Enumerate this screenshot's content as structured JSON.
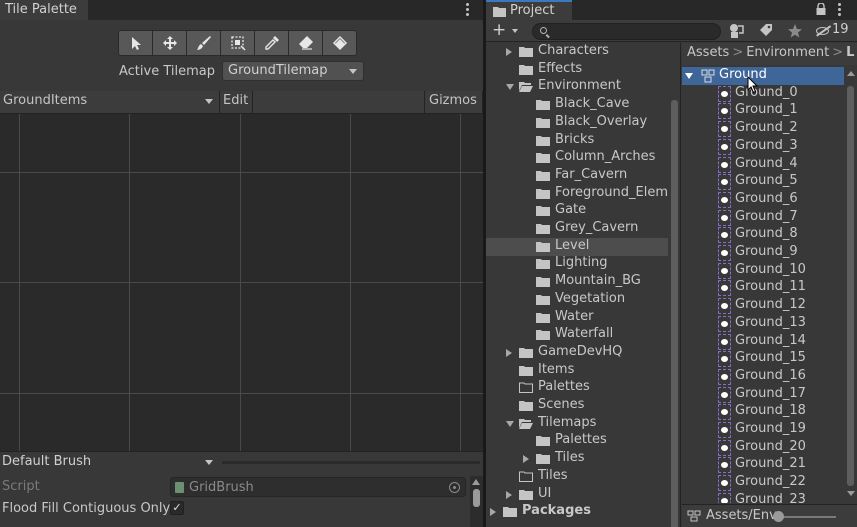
{
  "tile_palette": {
    "tab_title": "Tile Palette",
    "tools": [
      {
        "name": "select-tool-icon"
      },
      {
        "name": "move-tool-icon"
      },
      {
        "name": "paintbrush-tool-icon"
      },
      {
        "name": "box-fill-tool-icon"
      },
      {
        "name": "picker-tool-icon"
      },
      {
        "name": "eraser-tool-icon"
      },
      {
        "name": "fill-bucket-tool-icon"
      }
    ],
    "active_tilemap_label": "Active Tilemap",
    "active_tilemap_value": "GroundTilemap",
    "palette_dropdown": "GroundItems",
    "edit_label": "Edit",
    "gizmos_label": "Gizmos",
    "brush_dropdown": "Default Brush",
    "script_label": "Script",
    "script_value": "GridBrush",
    "flood_fill_label": "Flood Fill Contiguous Only",
    "flood_fill_checked": "✓"
  },
  "project": {
    "tab_title": "Project",
    "hidden_count": "19",
    "folders": [
      {
        "label": "Characters",
        "arrow": "right"
      },
      {
        "label": "Effects",
        "arrow": ""
      },
      {
        "label": "Environment",
        "arrow": "down"
      },
      {
        "label": "Black_Cave",
        "arrow": ""
      },
      {
        "label": "Black_Overlay",
        "arrow": ""
      },
      {
        "label": "Bricks",
        "arrow": ""
      },
      {
        "label": "Column_Arches",
        "arrow": ""
      },
      {
        "label": "Far_Cavern",
        "arrow": ""
      },
      {
        "label": "Foreground_Eleme",
        "arrow": ""
      },
      {
        "label": "Gate",
        "arrow": ""
      },
      {
        "label": "Grey_Cavern",
        "arrow": ""
      },
      {
        "label": "Level",
        "arrow": ""
      },
      {
        "label": "Lighting",
        "arrow": ""
      },
      {
        "label": "Mountain_BG",
        "arrow": ""
      },
      {
        "label": "Vegetation",
        "arrow": ""
      },
      {
        "label": "Water",
        "arrow": ""
      },
      {
        "label": "Waterfall",
        "arrow": ""
      },
      {
        "label": "GameDevHQ",
        "arrow": "right"
      },
      {
        "label": "Items",
        "arrow": ""
      },
      {
        "label": "Palettes",
        "arrow": ""
      },
      {
        "label": "Scenes",
        "arrow": ""
      },
      {
        "label": "Tilemaps",
        "arrow": "down"
      },
      {
        "label": "Palettes",
        "arrow": ""
      },
      {
        "label": "Tiles",
        "arrow": "right"
      },
      {
        "label": "Tiles",
        "arrow": ""
      },
      {
        "label": "UI",
        "arrow": "right"
      },
      {
        "label": "Packages",
        "arrow": "right"
      }
    ],
    "breadcrumb": [
      "Assets",
      "Environment",
      "L"
    ],
    "assets": [
      "Ground",
      "Ground_0",
      "Ground_1",
      "Ground_2",
      "Ground_3",
      "Ground_4",
      "Ground_5",
      "Ground_6",
      "Ground_7",
      "Ground_8",
      "Ground_9",
      "Ground_10",
      "Ground_11",
      "Ground_12",
      "Ground_13",
      "Ground_14",
      "Ground_15",
      "Ground_16",
      "Ground_17",
      "Ground_18",
      "Ground_19",
      "Ground_20",
      "Ground_21",
      "Ground_22",
      "Ground_23"
    ],
    "footer_path": "Assets/Env"
  },
  "colors": {
    "selection_blue": "#3e6699",
    "tab_accent": "#3a79bb",
    "panel_bg": "#383838",
    "grid_bg": "#2a2a2a"
  }
}
